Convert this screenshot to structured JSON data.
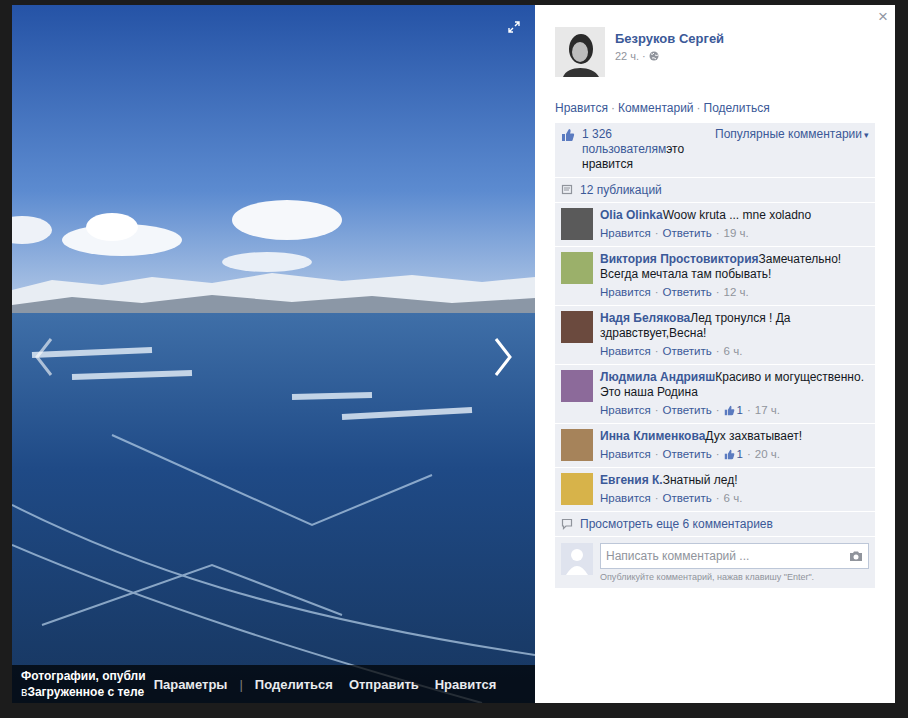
{
  "photo": {
    "caption_line1": "Фотографии, опубли",
    "caption_line2_prefix": "в",
    "caption_line2_link": "Загруженное с теле",
    "first_actions": [
      "Параметры"
    ],
    "divider": "|",
    "more_actions": [
      "Поделиться",
      "Отправить",
      "Нравится"
    ]
  },
  "close": "×",
  "post": {
    "author": "Безруков Сергей",
    "time": "22 ч.",
    "dot": "·"
  },
  "post_actions": [
    "Нравится",
    "Комментарий",
    "Поделиться"
  ],
  "separator": "·",
  "likes": {
    "count": "1 326 пользователям",
    "suffix": "это нравится"
  },
  "sort": {
    "label": "Популярные комментарии",
    "arrow": "▾"
  },
  "shares": "12 публикаций",
  "comments": [
    {
      "author": "Olia Olinka",
      "text": "Woow kruta ... mne xoladno",
      "like": "Нравится",
      "reply": "Ответить",
      "likes": null,
      "time": "19 ч."
    },
    {
      "author": "Виктория Простовиктория",
      "text": "Замечательно!Всегда мечтала там побывать!",
      "like": "Нравится",
      "reply": "Ответить",
      "likes": null,
      "time": "12 ч."
    },
    {
      "author": "Надя Белякова",
      "text": "Лед тронулся ! Да здравствует,Весна!",
      "like": "Нравится",
      "reply": "Ответить",
      "likes": null,
      "time": "6 ч."
    },
    {
      "author": "Людмила Андрияш",
      "text": "Красиво и могущественно. Это наша Родина",
      "like": "Нравится",
      "reply": "Ответить",
      "likes": "1",
      "time": "17 ч."
    },
    {
      "author": "Инна Клименкова",
      "text": "Дух захватывает!",
      "like": "Нравится",
      "reply": "Ответить",
      "likes": "1",
      "time": "20 ч."
    },
    {
      "author": "Евгения К.",
      "text": "Знатный лед!",
      "like": "Нравится",
      "reply": "Ответить",
      "likes": null,
      "time": "6 ч."
    }
  ],
  "more_comments": "Просмотреть еще 6 комментариев",
  "composer": {
    "placeholder": "Написать комментарий ...",
    "hint": "Опубликуйте комментарий, нажав клавишу \"Enter\"."
  }
}
